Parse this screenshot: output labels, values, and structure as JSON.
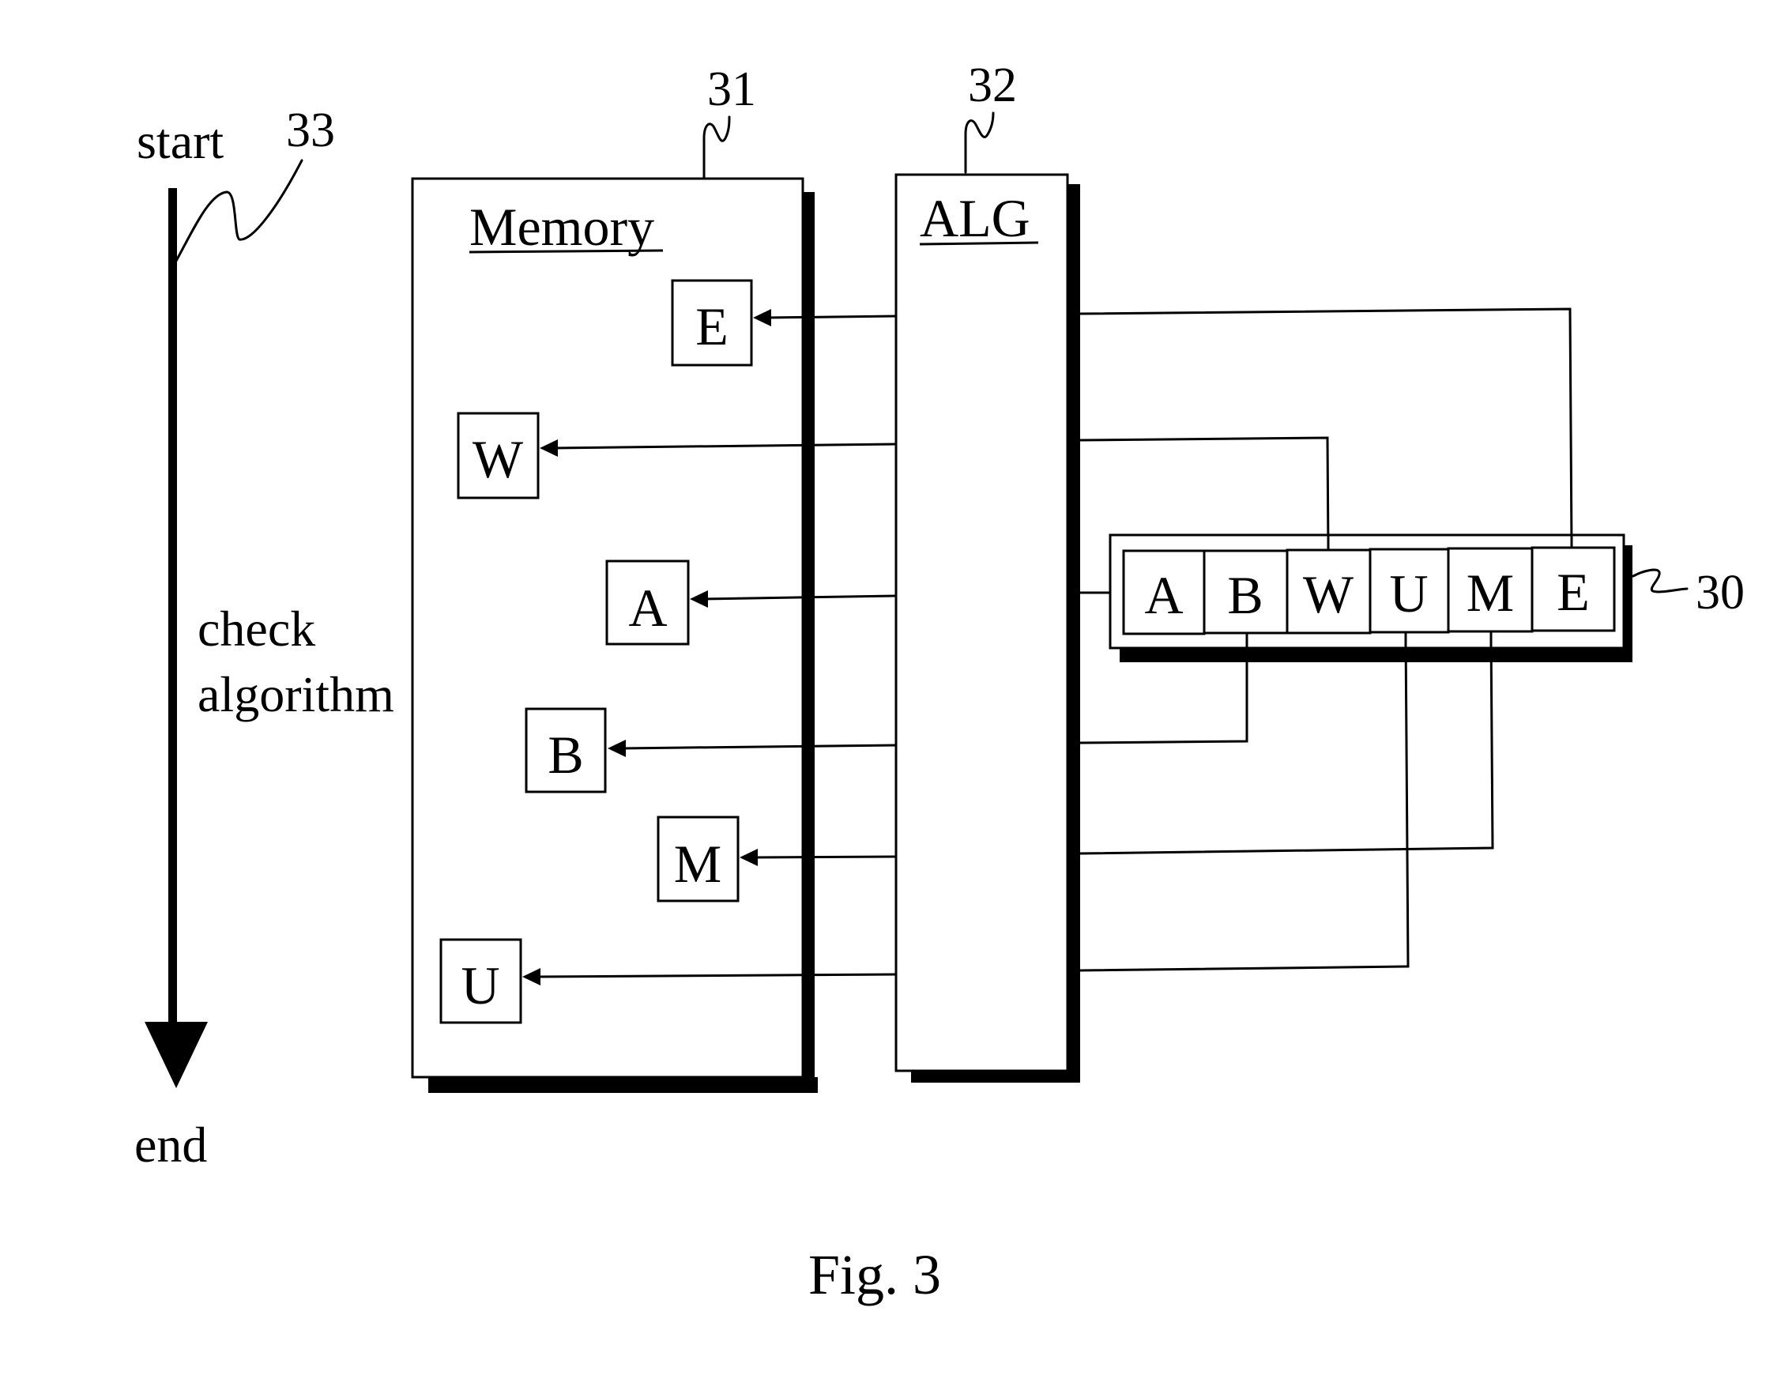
{
  "figure": {
    "caption": "Fig. 3",
    "flow": {
      "start_label": "start",
      "end_label": "end",
      "process_label_line1": "check",
      "process_label_line2": "algorithm",
      "ref_number": "33"
    },
    "memory": {
      "title": "Memory",
      "ref_number": "31",
      "items": [
        {
          "letter": "E"
        },
        {
          "letter": "W"
        },
        {
          "letter": "A"
        },
        {
          "letter": "B"
        },
        {
          "letter": "M"
        },
        {
          "letter": "U"
        }
      ]
    },
    "algorithm": {
      "title": "ALG",
      "ref_number": "32"
    },
    "sequence": {
      "ref_number": "30",
      "cells": [
        "A",
        "B",
        "W",
        "U",
        "M",
        "E"
      ]
    },
    "connections": [
      {
        "from_sequence_cell": "E",
        "to_memory_item": "E"
      },
      {
        "from_sequence_cell": "W",
        "to_memory_item": "W"
      },
      {
        "from_sequence_cell": "A",
        "to_memory_item": "A"
      },
      {
        "from_sequence_cell": "B",
        "to_memory_item": "B"
      },
      {
        "from_sequence_cell": "M",
        "to_memory_item": "M"
      },
      {
        "from_sequence_cell": "U",
        "to_memory_item": "U"
      }
    ]
  }
}
